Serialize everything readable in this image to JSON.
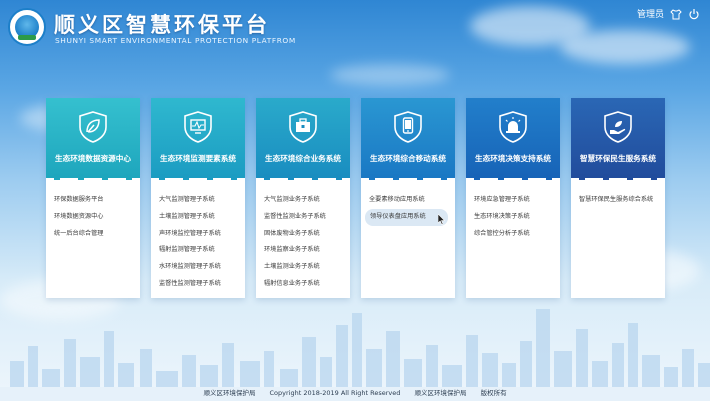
{
  "header": {
    "title": "顺义区智慧环保平台",
    "subtitle": "SHUNYI SMART ENVIRONMENTAL PROTECTION PLATFROM",
    "user": "管理员",
    "icons": [
      "user-icon",
      "power-icon"
    ]
  },
  "colors": {
    "card1": "#2bb3c6",
    "card2": "#25a8c6",
    "card3": "#2196c4",
    "card4": "#1d7fc7",
    "card5": "#1a66b9",
    "card6": "#2757a9"
  },
  "cards": [
    {
      "title": "生态环境数据资源中心",
      "icon": "leaf-icon",
      "items": [
        "环保数据服务平台",
        "环境数据资源中心",
        "统一后台综合管理"
      ]
    },
    {
      "title": "生态环境监测要素系统",
      "icon": "monitor-icon",
      "items": [
        "大气监测管理子系统",
        "土壤监测管理子系统",
        "声环境监控管理子系统",
        "辐射监测管理子系统",
        "水环境监测管理子系统",
        "监督性监测管理子系统"
      ]
    },
    {
      "title": "生态环境综合业务系统",
      "icon": "briefcase-icon",
      "items": [
        "大气监测业务子系统",
        "监督性监测业务子系统",
        "固体废物业务子系统",
        "环境监察业务子系统",
        "土壤监测业务子系统",
        "辐射信息业务子系统"
      ]
    },
    {
      "title": "生态环境综合移动系统",
      "icon": "mobile-icon",
      "items": [
        "全要素移动应用系统",
        "领导仪表盘应用系统"
      ]
    },
    {
      "title": "生态环境决策支持系统",
      "icon": "alarm-icon",
      "items": [
        "环境应急管理子系统",
        "生态环境决策子系统",
        "综合管控分析子系统"
      ]
    },
    {
      "title": "智慧环保民生服务系统",
      "icon": "hand-icon",
      "items": [
        "智慧环保民生服务综合系统"
      ]
    }
  ],
  "footer": {
    "org": "顺义区环境保护局",
    "copyright": "Copyright   2018-2019 All Right Reserved",
    "org2": "顺义区环境保护局",
    "rights": "版权所有"
  }
}
